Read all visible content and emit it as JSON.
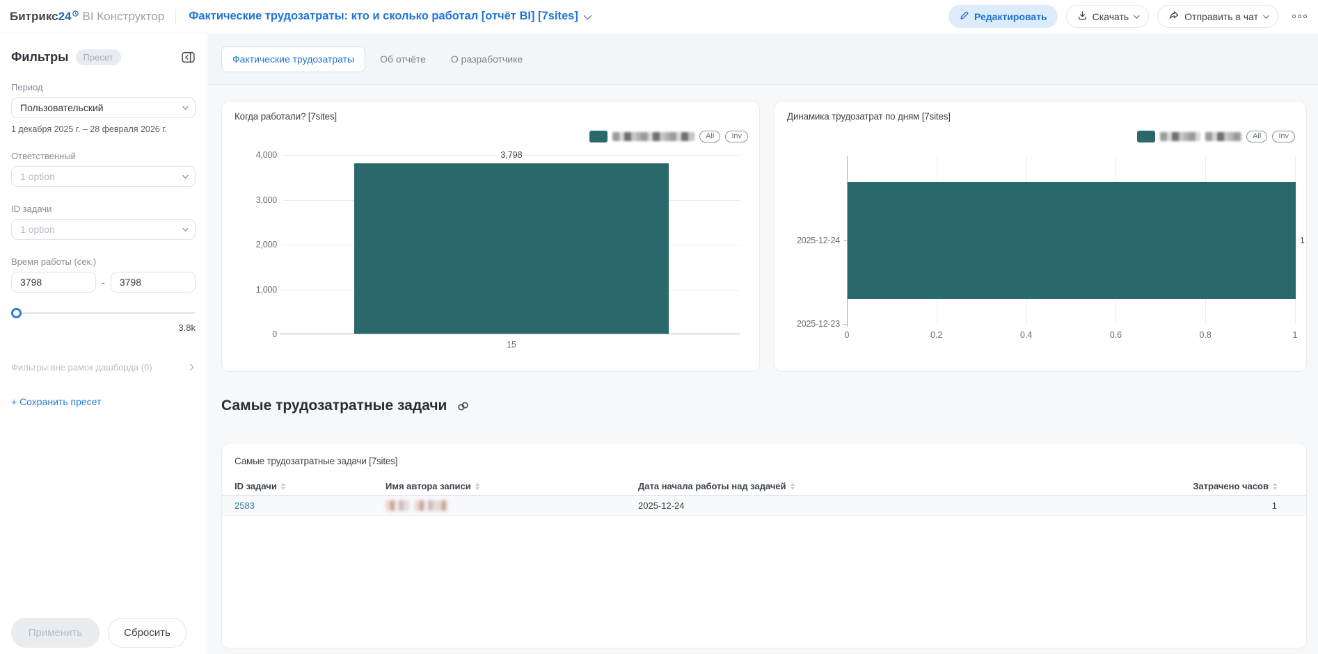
{
  "header": {
    "logo_primary": "Битрикс",
    "logo_number": "24",
    "logo_suffix": "BI Конструктор",
    "report_title": "Фактические трудозатраты: кто и сколько работал [отчёт BI] [7sites]",
    "edit_button": "Редактировать",
    "download_button": "Скачать",
    "send_to_chat_button": "Отправить в чат"
  },
  "sidebar": {
    "title": "Фильтры",
    "preset_badge": "Пресет",
    "period_label": "Период",
    "period_value": "Пользовательский",
    "period_range": "1 декабря 2025 г. – 28 февраля 2026 г.",
    "responsible_label": "Ответственный",
    "responsible_value": "1 option",
    "task_id_label": "ID задачи",
    "task_id_value": "1 option",
    "work_time_label": "Время работы (сек.)",
    "work_time_from": "3798",
    "work_time_to": "3798",
    "work_time_dash": "-",
    "slider_max_label": "3.8k",
    "outer_filters_label": "Фильтры вне рамок дашборда (0)",
    "save_preset_label": "+ Сохранить пресет",
    "apply_button": "Применить",
    "reset_button": "Сбросить"
  },
  "tabs": {
    "tab1": "Фактические трудозатраты",
    "tab2": "Об отчёте",
    "tab3": "О разработчике"
  },
  "chart_data": [
    {
      "type": "bar",
      "title": "Когда работали? [7sites]",
      "categories": [
        "15"
      ],
      "values": [
        3798
      ],
      "value_labels": [
        "3,798"
      ],
      "ylim": [
        0,
        4000
      ],
      "yticks": [
        "4,000",
        "3,000",
        "2,000",
        "1,000",
        "0"
      ],
      "bar_color": "#2b686c",
      "grid": true,
      "legend_position": "top-right",
      "legend": {
        "all": "All",
        "inv": "Inv"
      }
    },
    {
      "type": "bar",
      "orientation": "horizontal",
      "title": "Динамика трудозатрат по дням [7sites]",
      "categories": [
        "2025-12-24",
        "2025-12-23"
      ],
      "values": [
        1,
        0
      ],
      "value_labels": [
        "1"
      ],
      "xlim": [
        0,
        1
      ],
      "xticks": [
        "0",
        "0.2",
        "0.4",
        "0.6",
        "0.8",
        "1"
      ],
      "bar_color": "#2b686c",
      "grid": true,
      "legend_position": "top-right",
      "legend": {
        "all": "All",
        "inv": "Inv"
      }
    }
  ],
  "tasks_section": {
    "title": "Самые трудозатратные задачи"
  },
  "table": {
    "title": "Самые трудозатратные задачи [7sites]",
    "columns": [
      "ID задачи",
      "Имя автора записи",
      "Дата начала работы над задачей",
      "Затрачено часов"
    ],
    "rows": [
      {
        "task_id": "2583",
        "start_date": "2025-12-24",
        "hours": "1"
      }
    ]
  }
}
